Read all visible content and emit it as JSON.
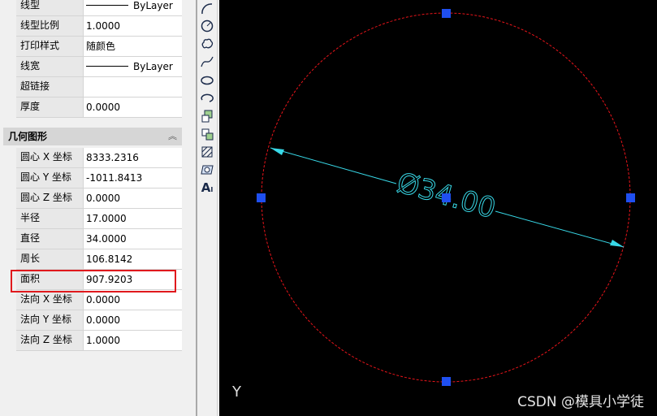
{
  "properties": {
    "general_rows": [
      {
        "key": "线型",
        "value": "ByLayer",
        "has_line": true
      },
      {
        "key": "线型比例",
        "value": "1.0000",
        "has_line": false
      },
      {
        "key": "打印样式",
        "value": "随颜色",
        "has_line": false
      },
      {
        "key": "线宽",
        "value": "ByLayer",
        "has_line": true
      },
      {
        "key": "超链接",
        "value": "",
        "has_line": false
      },
      {
        "key": "厚度",
        "value": "0.0000",
        "has_line": false
      }
    ],
    "geometry_section_title": "几何图形",
    "geometry_rows": [
      {
        "key": "圆心 X 坐标",
        "value": "8333.2316"
      },
      {
        "key": "圆心 Y 坐标",
        "value": "-1011.8413"
      },
      {
        "key": "圆心 Z 坐标",
        "value": "0.0000"
      },
      {
        "key": "半径",
        "value": "17.0000"
      },
      {
        "key": "直径",
        "value": "34.0000"
      },
      {
        "key": "周长",
        "value": "106.8142"
      },
      {
        "key": "面积",
        "value": "907.9203"
      },
      {
        "key": "法向 X 坐标",
        "value": "0.0000"
      },
      {
        "key": "法向 Y 坐标",
        "value": "0.0000"
      },
      {
        "key": "法向 Z 坐标",
        "value": "1.0000"
      }
    ]
  },
  "toolbar": {
    "tools": [
      "arc-icon",
      "circle-icon",
      "revision-cloud-icon",
      "spline-icon",
      "ellipse-icon",
      "ellipse-arc-icon",
      "insert-block-icon",
      "make-block-icon",
      "hatch-icon",
      "region-icon",
      "multiline-text-icon"
    ]
  },
  "canvas": {
    "dimension_text": "Ø34.00",
    "ucs_label": "Y",
    "watermark": "CSDN @模具小学徒",
    "colors": {
      "circle": "#e8141a",
      "dimension": "#38d9e8",
      "grip": "#1f4ff0"
    }
  }
}
